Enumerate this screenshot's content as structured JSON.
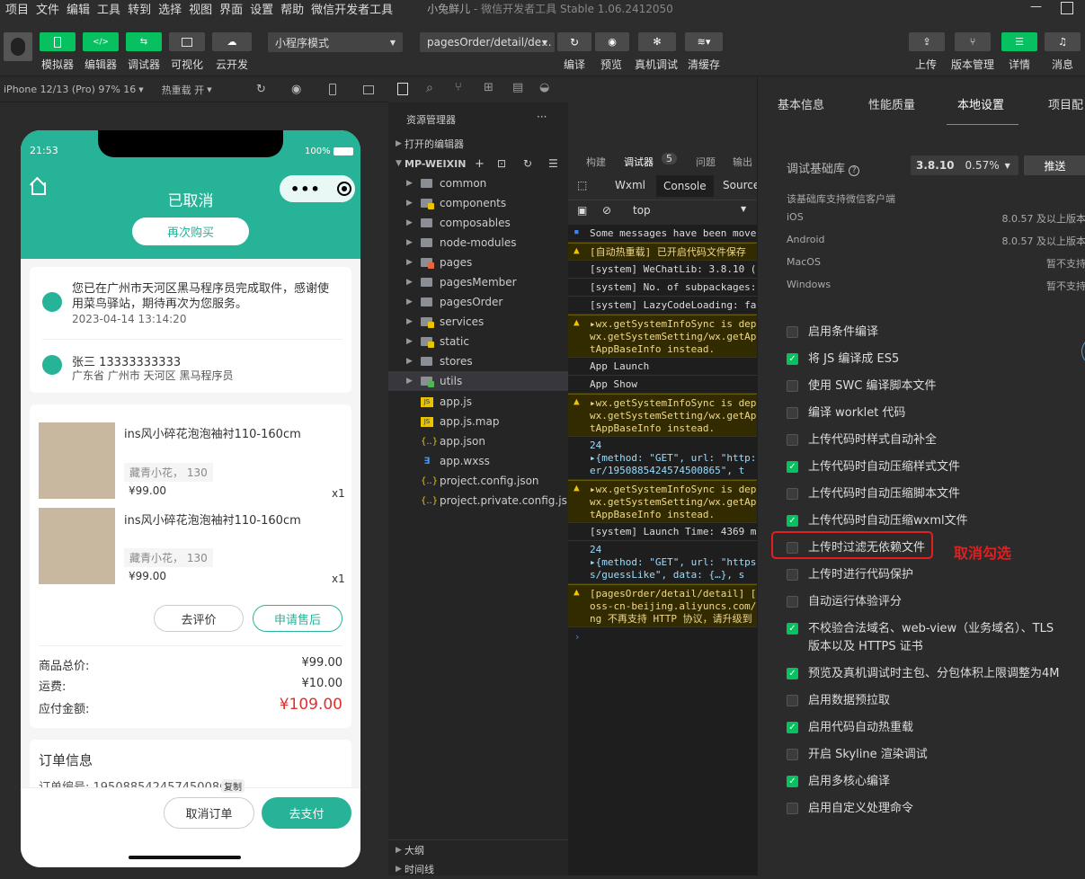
{
  "menubar": {
    "items": [
      "项目",
      "文件",
      "编辑",
      "工具",
      "转到",
      "选择",
      "视图",
      "界面",
      "设置",
      "帮助",
      "微信开发者工具"
    ],
    "title_app": "小兔鲜儿",
    "title_rest": " - 微信开发者工具 Stable 1.06.2412050",
    "minimize": "—"
  },
  "toolbar": {
    "left_buttons": [
      "模拟器",
      "编辑器",
      "调试器",
      "可视化",
      "云开发"
    ],
    "mode_select": "小程序模式",
    "page_select": "pagesOrder/detail/de...",
    "mid_buttons": [
      "编译",
      "预览",
      "真机调试",
      "清缓存"
    ],
    "right_buttons": [
      "上传",
      "版本管理",
      "详情",
      "消息"
    ]
  },
  "simbar": {
    "device": "iPhone 12/13 (Pro) 97% 16",
    "hot_reload": "热重载 开"
  },
  "phone": {
    "time": "21:53",
    "battery": "100%",
    "page_title": "已取消",
    "rebuy": "再次购买",
    "delivery_text": "您已在广州市天河区黑马程序员完成取件，感谢使用菜鸟驿站，期待再次为您服务。",
    "delivery_time": "2023-04-14 13:14:20",
    "receiver": "张三 13333333333",
    "address": "广东省 广州市 天河区 黑马程序员",
    "goods": [
      {
        "name": "ins风小碎花泡泡袖衬110-160cm",
        "spec": "藏青小花， 130",
        "price": "¥99.00",
        "qty": "x1"
      },
      {
        "name": "ins风小碎花泡泡袖衬110-160cm",
        "spec": "藏青小花， 130",
        "price": "¥99.00",
        "qty": "x1"
      }
    ],
    "review_btn": "去评价",
    "aftersale_btn": "申请售后",
    "summary": [
      {
        "label": "商品总价:",
        "value": "¥99.00"
      },
      {
        "label": "运费:",
        "value": "¥10.00"
      },
      {
        "label": "应付金额:",
        "value": "¥109.00"
      }
    ],
    "order_info_title": "订单信息",
    "order_no_label": "订单编号: 1950885424574500865",
    "copy": "复制",
    "cancel_btn": "取消订单",
    "pay_btn": "去支付"
  },
  "explorer": {
    "title": "资源管理器",
    "more": "···",
    "open_editors": "打开的编辑器",
    "project": "MP-WEIXIN",
    "folders": [
      "common",
      "components",
      "composables",
      "node-modules",
      "pages",
      "pagesMember",
      "pagesOrder",
      "services",
      "static",
      "stores",
      "utils"
    ],
    "files": [
      "app.js",
      "app.js.map",
      "app.json",
      "app.wxss",
      "project.config.json",
      "project.private.config.js..."
    ],
    "outline": "大纲",
    "timeline": "时间线"
  },
  "console": {
    "tabs": [
      "构建",
      "调试器",
      "问题",
      "输出"
    ],
    "badge": "5",
    "subtabs": [
      "Wxml",
      "Console",
      "Source"
    ],
    "context": "top",
    "lines": [
      {
        "type": "info",
        "text": "Some messages have been move"
      },
      {
        "type": "warn",
        "text": "[自动热重载] 已开启代码文件保存"
      },
      {
        "type": "log",
        "text": "[system] WeChatLib: 3.8.10 ("
      },
      {
        "type": "log",
        "text": "[system] No. of subpackages:"
      },
      {
        "type": "log",
        "text": "[system] LazyCodeLoading: fa"
      },
      {
        "type": "warn",
        "text": "▸wx.getSystemInfoSync is dep\nwx.getSystemSetting/wx.getAp\ntAppBaseInfo instead."
      },
      {
        "type": "log",
        "text": "App Launch"
      },
      {
        "type": "log",
        "text": "App Show"
      },
      {
        "type": "warn",
        "text": "▸wx.getSystemInfoSync is dep\nwx.getSystemSetting/wx.getAp\ntAppBaseInfo instead."
      },
      {
        "type": "obj",
        "text": "24\n▸{method: \"GET\", url: \"http:\ner/1950885424574500865\", t"
      },
      {
        "type": "warn",
        "text": "▸wx.getSystemInfoSync is dep\nwx.getSystemSetting/wx.getAp\ntAppBaseInfo instead."
      },
      {
        "type": "log",
        "text": "[system] Launch Time: 4369 m"
      },
      {
        "type": "obj",
        "text": "24\n▸{method: \"GET\", url: \"https\ns/guessLike\", data: {…}, s"
      },
      {
        "type": "warn",
        "text": "[pagesOrder/detail/detail] [\noss-cn-beijing.aliyuncs.com/\nng 不再支持 HTTP 协议，请升级到"
      }
    ],
    "prompt": "›"
  },
  "settings": {
    "tabs": [
      "基本信息",
      "性能质量",
      "本地设置",
      "项目配"
    ],
    "base_lib_label": "调试基础库",
    "base_lib_version": "3.8.10",
    "base_lib_pct": "0.57%",
    "push_btn": "推送",
    "support_title": "该基础库支持微信客户端",
    "os": [
      {
        "name": "iOS",
        "value": "8.0.57 及以上版本"
      },
      {
        "name": "Android",
        "value": "8.0.57 及以上版本"
      },
      {
        "name": "MacOS",
        "value": "暂不支持"
      },
      {
        "name": "Windows",
        "value": "暂不支持"
      }
    ],
    "options": [
      {
        "label": "启用条件编译",
        "checked": false
      },
      {
        "label": "将 JS 编译成 ES5",
        "checked": true
      },
      {
        "label": "使用 SWC 编译脚本文件",
        "checked": false
      },
      {
        "label": "编译 worklet 代码",
        "checked": false
      },
      {
        "label": "上传代码时样式自动补全",
        "checked": false
      },
      {
        "label": "上传代码时自动压缩样式文件",
        "checked": true
      },
      {
        "label": "上传代码时自动压缩脚本文件",
        "checked": false
      },
      {
        "label": "上传代码时自动压缩wxml文件",
        "checked": true
      },
      {
        "label": "上传时过滤无依赖文件",
        "checked": false
      },
      {
        "label": "上传时进行代码保护",
        "checked": false
      },
      {
        "label": "自动运行体验评分",
        "checked": false
      },
      {
        "label": "不校验合法域名、web-view（业务域名）、TLS 版本以及 HTTPS 证书",
        "checked": true
      },
      {
        "label": "预览及真机调试时主包、分包体积上限调整为4M",
        "checked": true
      },
      {
        "label": "启用数据预拉取",
        "checked": false
      },
      {
        "label": "启用代码自动热重载",
        "checked": true
      },
      {
        "label": "开启 Skyline 渲染调试",
        "checked": false
      },
      {
        "label": "启用多核心编译",
        "checked": true
      },
      {
        "label": "启用自定义处理命令",
        "checked": false
      }
    ],
    "annotation": "取消勾选"
  },
  "colors": {
    "brand_green": "#07c160",
    "theme_teal": "#27b397",
    "price_red": "#e0302e",
    "annotation_red": "#e02020"
  }
}
